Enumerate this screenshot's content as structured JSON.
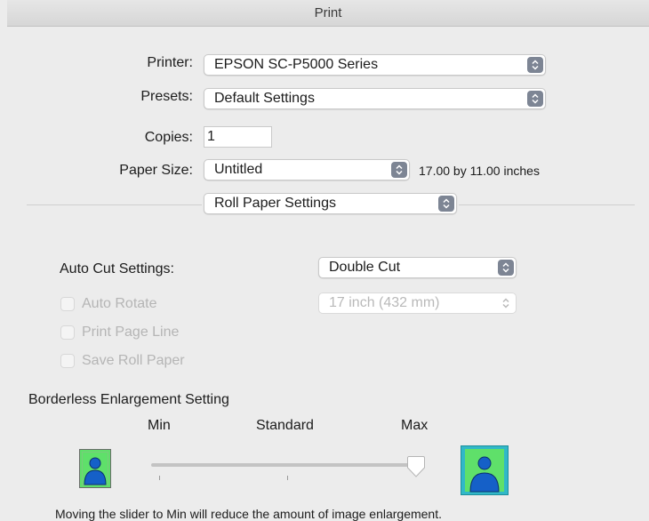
{
  "window": {
    "title": "Print"
  },
  "printer": {
    "label": "Printer:",
    "value": "EPSON SC-P5000 Series"
  },
  "presets": {
    "label": "Presets:",
    "value": "Default Settings"
  },
  "copies": {
    "label": "Copies:",
    "value": "1"
  },
  "paper_size": {
    "label": "Paper Size:",
    "value": "Untitled",
    "dimensions": "17.00 by 11.00 inches"
  },
  "panel": {
    "value": "Roll Paper Settings"
  },
  "auto_cut": {
    "label": "Auto Cut Settings:",
    "value": "Double Cut"
  },
  "roll_width": {
    "value": "17 inch (432 mm)",
    "enabled": false
  },
  "checkboxes": [
    {
      "label": "Auto Rotate",
      "checked": false,
      "enabled": false
    },
    {
      "label": "Print Page Line",
      "checked": false,
      "enabled": false
    },
    {
      "label": "Save Roll Paper",
      "checked": false,
      "enabled": false
    }
  ],
  "borderless": {
    "title": "Borderless Enlargement Setting",
    "labels": {
      "min": "Min",
      "standard": "Standard",
      "max": "Max"
    },
    "level": 1.0,
    "note": "Moving the slider to Min will reduce the amount of image enlargement."
  },
  "colors": {
    "stepper": "#7d8594",
    "thumb_bg": "#5fe06a",
    "figure": "#1560c8",
    "selected_frame": "#31b8c8"
  },
  "icons": {
    "stepper": "up-down-chevron-icon",
    "min_preview": "person-thumbnail-icon",
    "max_preview": "person-thumbnail-icon"
  }
}
